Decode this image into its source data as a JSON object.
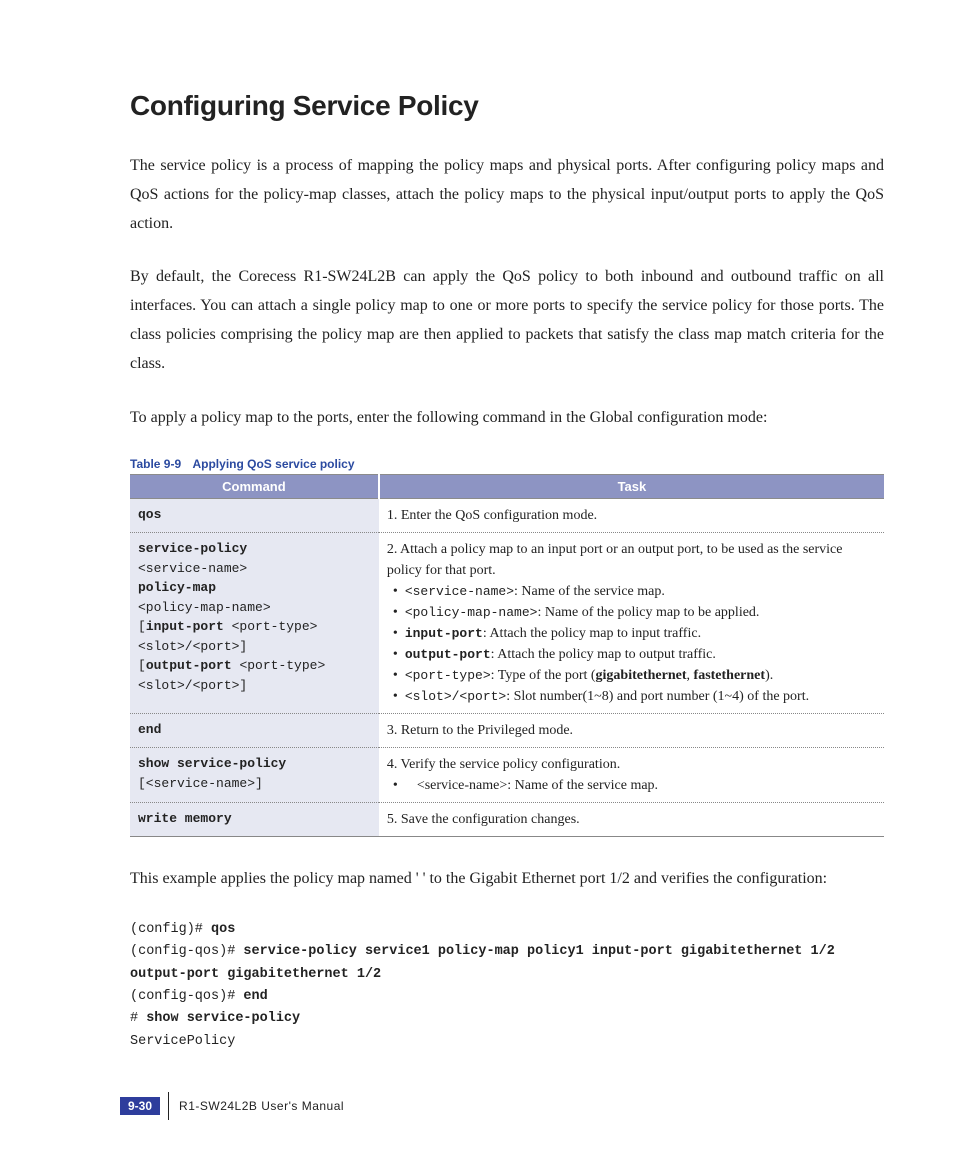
{
  "title": "Configuring Service Policy",
  "para1": "The service policy is a process of mapping the policy maps and physical ports. After configuring policy maps and QoS actions for the policy-map classes, attach the policy maps to the physical input/output ports to apply the QoS action.",
  "para2": "By default, the Corecess R1-SW24L2B can apply the QoS policy to both inbound and outbound traffic on all interfaces. You can attach a single policy map to one or more ports to specify the service policy for those ports. The class policies comprising the policy map are then applied to packets that satisfy the class map match criteria for the class.",
  "para3": "To apply a policy map to the ports, enter the following command in the Global configuration mode:",
  "table_caption_num": "Table 9-9",
  "table_caption_txt": "Applying QoS service policy",
  "th_cmd": "Command",
  "th_task": "Task",
  "rows": {
    "r1": {
      "cmd": "qos",
      "task": "1. Enter the QoS configuration mode."
    },
    "r2": {
      "cmd_l1b": "service-policy",
      "cmd_l2": "<service-name>",
      "cmd_l3b": "policy-map",
      "cmd_l4": "<policy-map-name>",
      "cmd_l5a": "[",
      "cmd_l5b": "input-port",
      "cmd_l5c": " <port-type>",
      "cmd_l6": "<slot>/<port>]",
      "cmd_l7a": "[",
      "cmd_l7b": "output-port",
      "cmd_l7c": " <port-type>",
      "cmd_l8": "<slot>/<port>]",
      "task_lead": "2. Attach a policy map to an input port or an output port, to be used as the service policy for that port.",
      "b1a": "<service-name>",
      "b1b": ": Name of the service map.",
      "b2a": "<policy-map-name>",
      "b2b": ": Name of the policy map to be applied.",
      "b3a": "input-port",
      "b3b": ": Attach the policy map to input traffic.",
      "b4a": "output-port",
      "b4b": ": Attach the policy map to output traffic.",
      "b5a": "<port-type>",
      "b5b": ": Type of the port (",
      "b5c": "gigabitethernet",
      "b5d": ", ",
      "b5e": "fastethernet",
      "b5f": ").",
      "b6a": "<slot>/<port>",
      "b6b": ": Slot number(1~8) and port number (1~4) of the port."
    },
    "r3": {
      "cmd": "end",
      "task": "3. Return to the Privileged mode."
    },
    "r4": {
      "cmd_l1b": "show service-policy",
      "cmd_l2": "[<service-name>]",
      "task_lead": "4. Verify the service policy configuration.",
      "b1": "<service-name>: Name of the service map."
    },
    "r5": {
      "cmd": "write memory",
      "task": "5. Save the configuration changes."
    }
  },
  "para4": "This example applies the policy map named '        ' to the Gigabit Ethernet port 1/2 and verifies the configuration:",
  "example": {
    "l1a": "(config)# ",
    "l1b": "qos",
    "l2a": "(config-qos)# ",
    "l2b": "service-policy service1 policy-map policy1 input-port gigabitethernet 1/2 output-port gigabitethernet 1/2",
    "l3a": "(config-qos)# ",
    "l3b": "end",
    "l4a": "# ",
    "l4b": "show service-policy",
    "l5": "ServicePolicy"
  },
  "footer": {
    "page": "9-30",
    "doc": "R1-SW24L2B   User's Manual"
  }
}
